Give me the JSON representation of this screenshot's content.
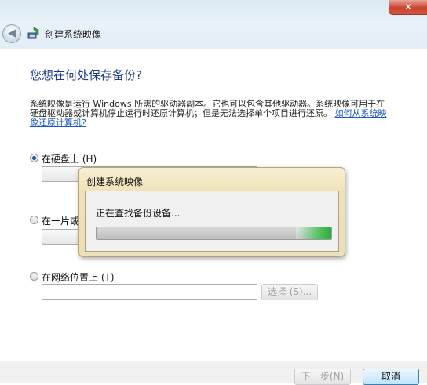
{
  "window": {
    "title": "创建系统映像",
    "close_glyph": "✕",
    "back_glyph": "◀"
  },
  "page": {
    "heading": "您想在何处保存备份?",
    "description": "系统映像是运行 Windows 所需的驱动器副本。它也可以包含其他驱动器。系统映像可用于在硬盘驱动器或计算机停止运行时还原计算机；但是无法选择单个项目进行还原。",
    "help_link": "如何从系统映像还原计算机?"
  },
  "options": {
    "hard_disk": {
      "label": "在硬盘上 (H)",
      "selected": true
    },
    "dvd": {
      "label": "在一片或",
      "selected": false
    },
    "network": {
      "label": "在网络位置上 (T)",
      "selected": false,
      "path_value": "",
      "select_label": "选择 (S)..."
    }
  },
  "footer": {
    "next_label": "下一步(N)",
    "cancel_label": "取消"
  },
  "progress_dialog": {
    "title": "创建系统映像",
    "message": "正在查找备份设备...",
    "progress": 0.85,
    "accent": "#4cc15a"
  },
  "colors": {
    "heading": "#1c3b8a",
    "link": "#1a56c8",
    "close": "#c7452f"
  }
}
